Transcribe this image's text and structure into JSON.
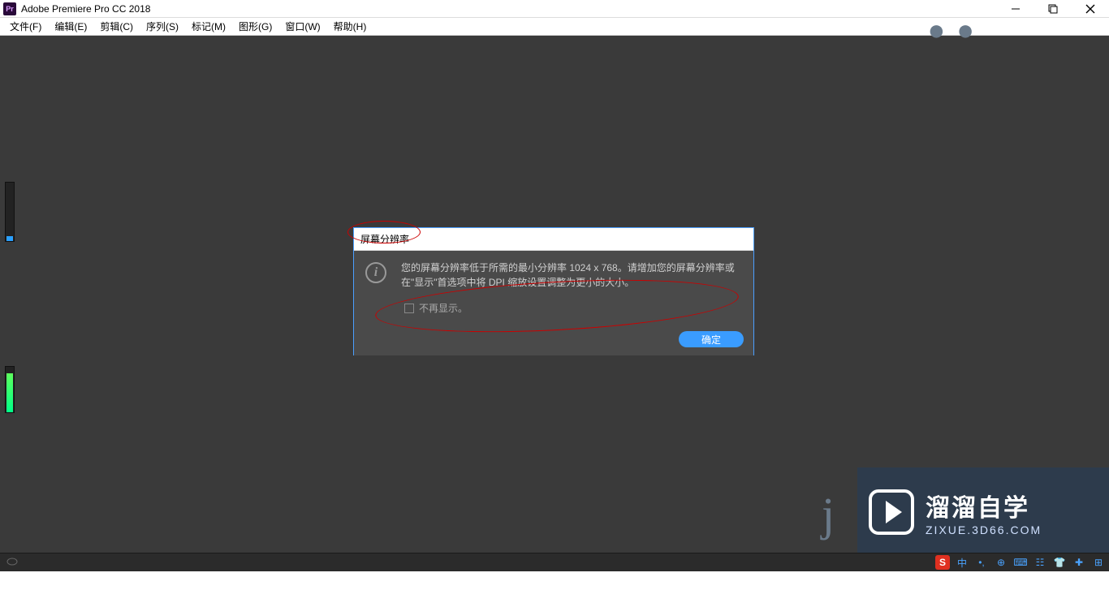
{
  "titlebar": {
    "app_icon_label": "Pr",
    "title": "Adobe Premiere Pro CC 2018"
  },
  "menu": {
    "items": [
      "文件(F)",
      "编辑(E)",
      "剪辑(C)",
      "序列(S)",
      "标记(M)",
      "图形(G)",
      "窗口(W)",
      "帮助(H)"
    ]
  },
  "dialog": {
    "title": "屏幕分辨率",
    "message": "您的屏幕分辨率低于所需的最小分辨率 1024 x 768。请增加您的屏幕分辨率或在\"显示\"首选项中将 DPI 缩放设置调整为更小的大小。",
    "checkbox_label": "不再显示。",
    "ok_label": "确定"
  },
  "watermark": {
    "line1": "溜溜自学",
    "line2": "ZIXUE.3D66.COM"
  },
  "tray": {
    "items": [
      "S",
      "中",
      "•,",
      "⊕",
      "⌨",
      "☷",
      "👕",
      "✚",
      "⊞"
    ]
  }
}
